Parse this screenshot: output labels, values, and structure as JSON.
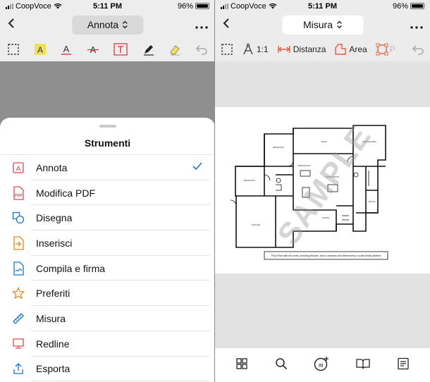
{
  "left": {
    "status": {
      "carrier": "CoopVoce",
      "time": "5:11 PM",
      "battery": "96%"
    },
    "title": "Annota",
    "toolbar_icons": [
      "selection-icon",
      "highlight-icon",
      "text-color-icon",
      "strikethrough-icon",
      "text-box-icon",
      "pen-icon",
      "eraser-icon",
      "undo-icon"
    ],
    "sheet_title": "Strumenti",
    "menu": [
      {
        "label": "Annota",
        "icon": "annotate-icon",
        "selected": true
      },
      {
        "label": "Modifica PDF",
        "icon": "edit-pdf-icon",
        "selected": false
      },
      {
        "label": "Disegna",
        "icon": "draw-shapes-icon",
        "selected": false
      },
      {
        "label": "Inserisci",
        "icon": "insert-icon",
        "selected": false
      },
      {
        "label": "Compila e firma",
        "icon": "fill-sign-icon",
        "selected": false
      },
      {
        "label": "Preferiti",
        "icon": "star-icon",
        "selected": false
      },
      {
        "label": "Misura",
        "icon": "ruler-icon",
        "selected": false
      },
      {
        "label": "Redline",
        "icon": "redline-icon",
        "selected": false
      },
      {
        "label": "Esporta",
        "icon": "share-icon",
        "selected": false
      }
    ]
  },
  "right": {
    "status": {
      "carrier": "CoopVoce",
      "time": "5:11 PM",
      "battery": "96%"
    },
    "title": "Misura",
    "toolbar": {
      "scale": "1:1",
      "distance": "Distanza",
      "area": "Area",
      "perimeter_partial": "P"
    },
    "plan_caption": "Floor Plan with all rooms, plumbing fixtures, doors, windows and dimensions or scale clearly labeled",
    "watermark": "SAMPLE",
    "bottom_icons": [
      "thumbnails-icon",
      "search-icon",
      "ai-assistant-icon",
      "reading-mode-icon",
      "comments-list-icon"
    ]
  },
  "colors": {
    "accent": "#1473e6",
    "annotation": "#e34850",
    "highlight_yellow": "#f1e05a",
    "menu_icon": "#e34850"
  }
}
